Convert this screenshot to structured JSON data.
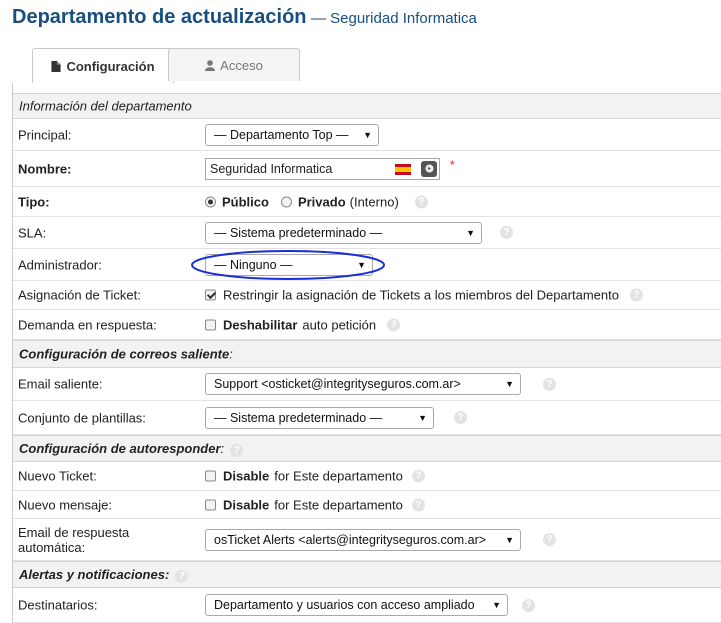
{
  "header": {
    "title": "Departamento de actualización",
    "subtitle": "— Seguridad Informatica"
  },
  "tabs": [
    {
      "label": "Configuración",
      "icon": "file-icon",
      "active": true
    },
    {
      "label": "Acceso",
      "icon": "user-icon",
      "active": false
    }
  ],
  "sections": {
    "info": "Información del departamento",
    "mail": "Configuración de correos saliente",
    "mail_suffix": ":",
    "autoresp": "Configuración de autoresponder",
    "autoresp_suffix": ":",
    "alerts": "Alertas y notificaciones:"
  },
  "fields": {
    "principal": {
      "label": "Principal:",
      "value": "— Departamento Top —"
    },
    "nombre": {
      "label": "Nombre:",
      "value": "Seguridad Informatica",
      "required": "*"
    },
    "tipo": {
      "label": "Tipo:",
      "opt1": "Público",
      "opt2": "Privado",
      "opt2_note": "(Interno)"
    },
    "sla": {
      "label": "SLA:",
      "value": "— Sistema predeterminado —"
    },
    "admin": {
      "label": "Administrador:",
      "value": "— Ninguno —"
    },
    "asignacion": {
      "label": "Asignación de Ticket:",
      "text": "Restringir la asignación de Tickets a los miembros del Departamento"
    },
    "demanda": {
      "label": "Demanda en respuesta:",
      "bold": "Deshabilitar",
      "text": "auto petición"
    },
    "email_saliente": {
      "label": "Email saliente:",
      "value": "Support <osticket@integrityseguros.com.ar>"
    },
    "plantillas": {
      "label": "Conjunto de plantillas:",
      "value": "— Sistema predeterminado —"
    },
    "nuevo_ticket": {
      "label": "Nuevo Ticket:",
      "bold": "Disable",
      "text": "for Este departamento"
    },
    "nuevo_mensaje": {
      "label": "Nuevo mensaje:",
      "bold": "Disable",
      "text": "for Este departamento"
    },
    "email_respuesta": {
      "label": "Email de respuesta automática:",
      "value": "osTicket Alerts <alerts@integrityseguros.com.ar>"
    },
    "destinatarios": {
      "label": "Destinatarios:",
      "value": "Departamento y usuarios con acceso ampliado"
    }
  },
  "help_glyph": "?",
  "caret_glyph": "▼",
  "colors": {
    "title": "#184e81",
    "annotation": "#1a2fd6",
    "required": "#dd2222"
  }
}
